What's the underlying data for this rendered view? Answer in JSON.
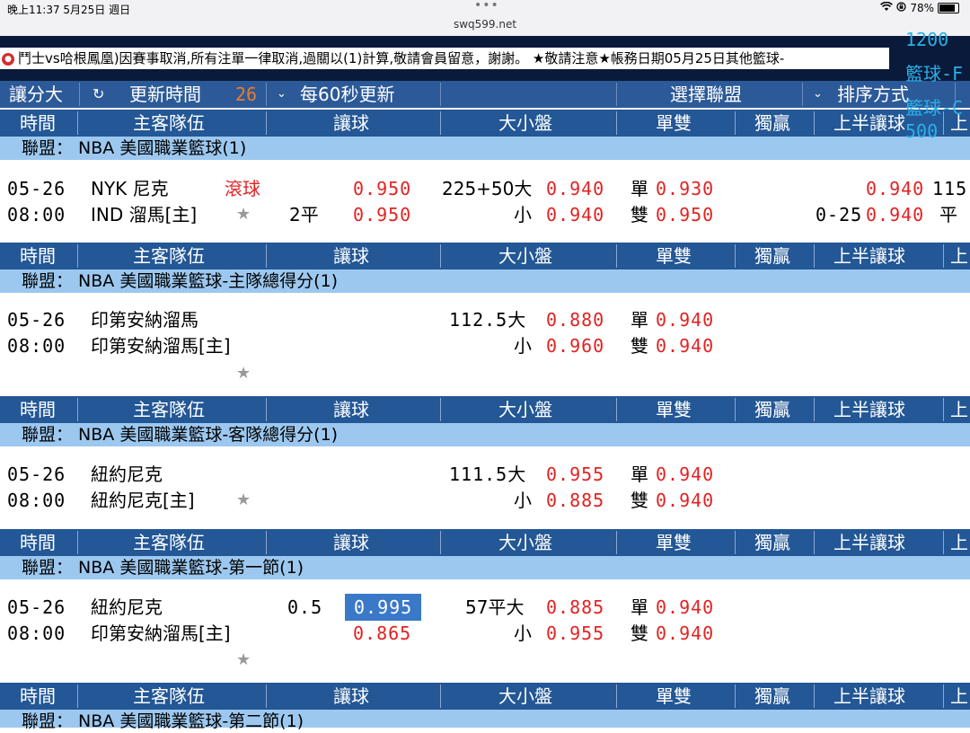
{
  "status": {
    "time": "晚上11:37  5月25日 週日",
    "url": "swq599.net",
    "battery": "78%"
  },
  "ticker": {
    "text": "鬥士vs哈根鳳凰)因賽事取消,所有注單一律取消,過關以(1)計算,敬請會員留意，謝謝。  ★敬請注意★帳務日期05月25日其他籃球-"
  },
  "overlay": {
    "line1": "1200",
    "line2": "籃球-F",
    "line3": "籃球-C",
    "line4": "500"
  },
  "controls": {
    "mode": "讓分大",
    "refresh_label": "更新時間",
    "countdown": "26",
    "interval": "每60秒更新",
    "league_select": "選擇聯盟",
    "sort": "排序方式"
  },
  "columns": {
    "time": "時間",
    "teams": "主客隊伍",
    "handicap": "讓球",
    "overunder": "大小盤",
    "oddeven": "單雙",
    "moneyline": "獨贏",
    "first_half": "上半讓球",
    "more": "上"
  },
  "sections": [
    {
      "league": "聯盟： NBA 美國職業籃球(1)",
      "date": "05-26",
      "time": "08:00",
      "team1": "NYK 尼克",
      "team2": "IND 溜馬[主]",
      "live": "滾球",
      "hcap_line": "2平",
      "hcap_odds1": "0.950",
      "hcap_odds2": "0.950",
      "ou_line": "225+50大",
      "ou_under": "小",
      "ou_odds1": "0.940",
      "ou_odds2": "0.940",
      "odd_label": "單",
      "even_label": "雙",
      "odd_odds": "0.930",
      "even_odds": "0.950",
      "fh_line": "0-25",
      "fh_odds1": "0.940",
      "fh_odds2": "0.940",
      "extra1": "115",
      "extra2": "平"
    },
    {
      "league": "聯盟： NBA 美國職業籃球-主隊總得分(1)",
      "date": "05-26",
      "time": "08:00",
      "team1": "印第安納溜馬",
      "team2": "印第安納溜馬[主]",
      "ou_line": "112.5大",
      "ou_under": "小",
      "ou_odds1": "0.880",
      "ou_odds2": "0.960",
      "odd_label": "單",
      "even_label": "雙",
      "odd_odds": "0.940",
      "even_odds": "0.940"
    },
    {
      "league": "聯盟： NBA 美國職業籃球-客隊總得分(1)",
      "date": "05-26",
      "time": "08:00",
      "team1": "紐約尼克",
      "team2": "紐約尼克[主]",
      "ou_line": "111.5大",
      "ou_under": "小",
      "ou_odds1": "0.955",
      "ou_odds2": "0.885",
      "odd_label": "單",
      "even_label": "雙",
      "odd_odds": "0.940",
      "even_odds": "0.940"
    },
    {
      "league": "聯盟： NBA 美國職業籃球-第一節(1)",
      "date": "05-26",
      "time": "08:00",
      "team1": "紐約尼克",
      "team2": "印第安納溜馬[主]",
      "hcap_line": "0.5",
      "hcap_odds1": "0.995",
      "hcap_odds2": "0.865",
      "ou_line": "57平大",
      "ou_under": "小",
      "ou_odds1": "0.885",
      "ou_odds2": "0.955",
      "odd_label": "單",
      "even_label": "雙",
      "odd_odds": "0.940",
      "even_odds": "0.940"
    },
    {
      "league": "聯盟： NBA 美國職業籃球-第二節(1)"
    }
  ]
}
